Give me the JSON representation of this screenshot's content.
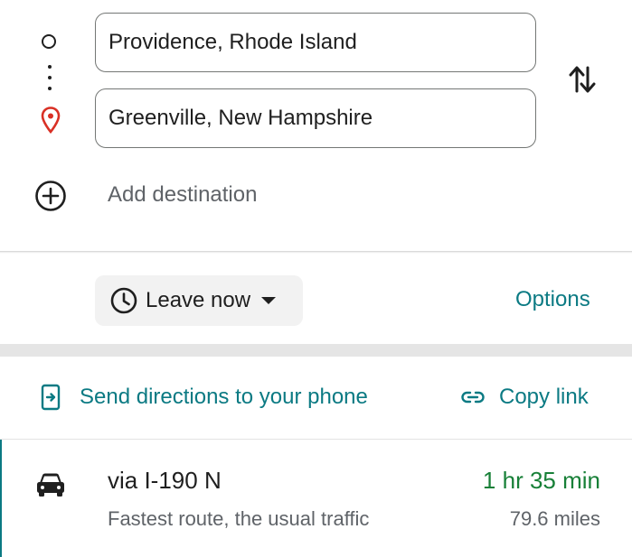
{
  "waypoints": {
    "origin_value": "Providence, Rhode Island",
    "destination_value": "Greenville, New Hampshire",
    "add_destination_label": "Add destination",
    "icons": {
      "origin": "origin-circle-icon",
      "route_dots": "route-dots-icon",
      "destination": "destination-pin-icon",
      "swap": "swap-direction-icon",
      "add": "add-circle-icon"
    }
  },
  "departure": {
    "label": "Leave now",
    "icon": "clock-icon",
    "options_label": "Options"
  },
  "share": {
    "send_label": "Send directions to your phone",
    "send_icon": "send-to-phone-icon",
    "copy_label": "Copy link",
    "copy_icon": "link-icon"
  },
  "routes": [
    {
      "mode_icon": "car-icon",
      "name": "via I-190 N",
      "description": "Fastest route, the usual traffic",
      "duration": "1 hr 35 min",
      "distance": "79.6 miles"
    }
  ],
  "colors": {
    "accent_teal": "#0b7a83",
    "duration_green": "#188038",
    "pin_red": "#d93025",
    "secondary_text": "#5f6368"
  }
}
